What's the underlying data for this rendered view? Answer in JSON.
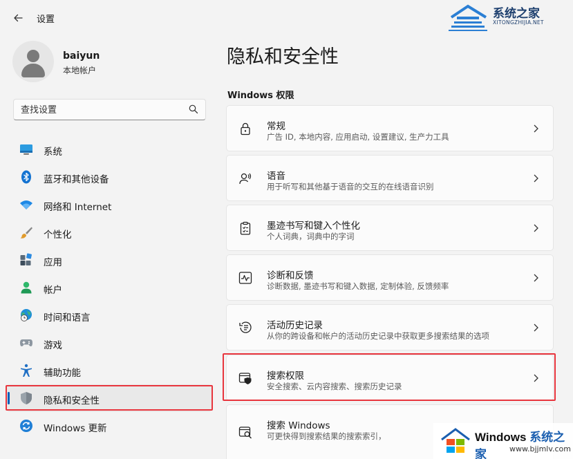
{
  "app": {
    "title": "设置"
  },
  "watermark_top": {
    "cn": "系统之家",
    "en": "XITONGZHIJIA.NET"
  },
  "profile": {
    "name": "baiyun",
    "type": "本地帐户"
  },
  "search": {
    "placeholder": "查找设置"
  },
  "sidebar": {
    "items": [
      {
        "label": "系统",
        "icon": "monitor-icon"
      },
      {
        "label": "蓝牙和其他设备",
        "icon": "bluetooth-icon"
      },
      {
        "label": "网络和 Internet",
        "icon": "wifi-icon"
      },
      {
        "label": "个性化",
        "icon": "brush-icon"
      },
      {
        "label": "应用",
        "icon": "apps-icon"
      },
      {
        "label": "帐户",
        "icon": "account-icon"
      },
      {
        "label": "时间和语言",
        "icon": "globe-clock-icon"
      },
      {
        "label": "游戏",
        "icon": "gamepad-icon"
      },
      {
        "label": "辅助功能",
        "icon": "accessibility-icon"
      },
      {
        "label": "隐私和安全性",
        "icon": "shield-icon",
        "selected": true
      },
      {
        "label": "Windows 更新",
        "icon": "update-icon"
      }
    ]
  },
  "main": {
    "title": "隐私和安全性",
    "section": "Windows 权限",
    "cards": [
      {
        "title": "常规",
        "subtitle": "广告 ID, 本地内容, 应用启动, 设置建议, 生产力工具",
        "icon": "lock-icon"
      },
      {
        "title": "语音",
        "subtitle": "用于听写和其他基于语音的交互的在线语音识别",
        "icon": "speech-icon"
      },
      {
        "title": "墨迹书写和键入个性化",
        "subtitle": "个人词典，词典中的字词",
        "icon": "clipboard-icon"
      },
      {
        "title": "诊断和反馈",
        "subtitle": "诊断数据, 墨迹书写和键入数据, 定制体验, 反馈频率",
        "icon": "pulse-icon"
      },
      {
        "title": "活动历史记录",
        "subtitle": "从你的跨设备和帐户的活动历史记录中获取更多搜索结果的选项",
        "icon": "history-icon"
      },
      {
        "title": "搜索权限",
        "subtitle": "安全搜索、云内容搜索、搜索历史记录",
        "icon": "search-shield-icon"
      },
      {
        "title": "搜索 Windows",
        "subtitle": "可更快得到搜索结果的搜索索引，",
        "icon": "search-windows-icon"
      }
    ]
  },
  "watermark_bottom": {
    "part1": "Windows ",
    "part2": "系统之家",
    "url": "www.bjjmlv.com"
  },
  "colors": {
    "accent": "#005fb8",
    "highlight": "#e8353d"
  }
}
